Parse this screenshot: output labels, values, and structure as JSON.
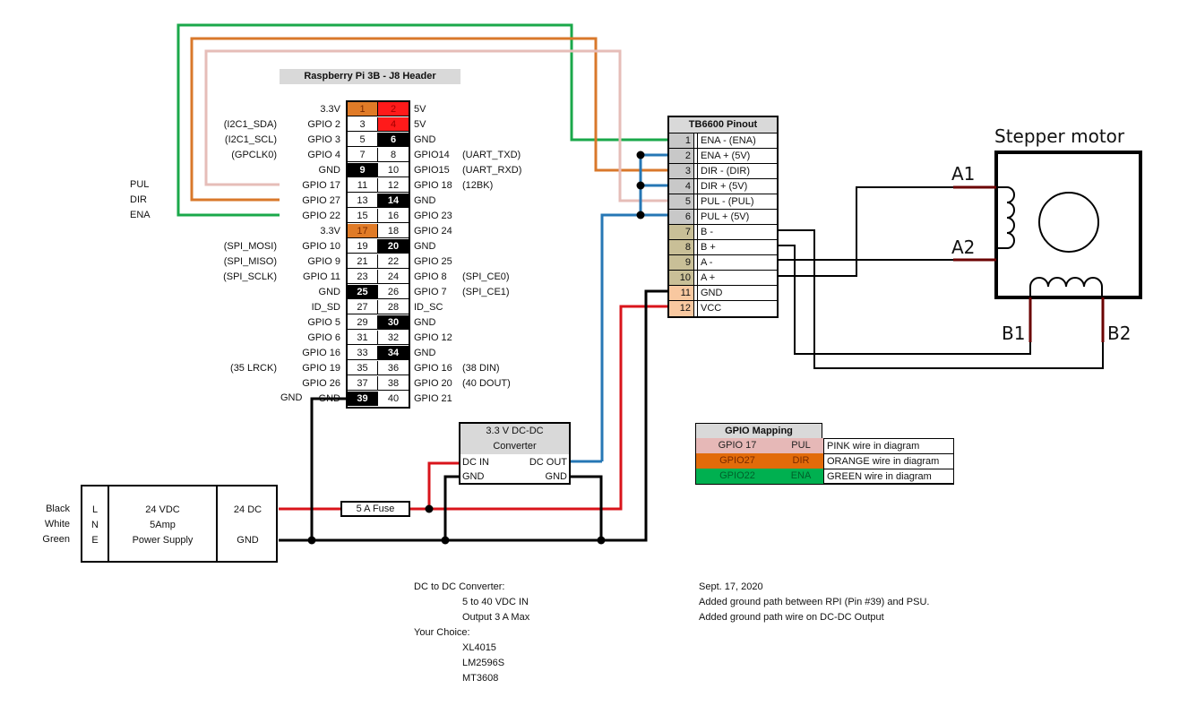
{
  "pi": {
    "title": "Raspberry Pi 3B - J8 Header",
    "rows": [
      {
        "lnote": "",
        "lname": "3.3V",
        "l": "1",
        "lc": "c-33",
        "r": "2",
        "rc": "c-5v",
        "rname": "5V",
        "rnote": ""
      },
      {
        "lnote": "(I2C1_SDA)",
        "lname": "GPIO 2",
        "l": "3",
        "lc": "",
        "r": "4",
        "rc": "c-5v",
        "rname": "5V",
        "rnote": ""
      },
      {
        "lnote": "(I2C1_SCL)",
        "lname": "GPIO 3",
        "l": "5",
        "lc": "",
        "r": "6",
        "rc": "c-gnd",
        "rname": "GND",
        "rnote": ""
      },
      {
        "lnote": "(GPCLK0)",
        "lname": "GPIO 4",
        "l": "7",
        "lc": "",
        "r": "8",
        "rc": "",
        "rname": "GPIO14",
        "rnote": "(UART_TXD)"
      },
      {
        "lnote": "",
        "lname": "GND",
        "l": "9",
        "lc": "c-gnd",
        "r": "10",
        "rc": "",
        "rname": "GPIO15",
        "rnote": "(UART_RXD)"
      },
      {
        "lnote": "",
        "lname": "GPIO 17",
        "l": "11",
        "lc": "",
        "r": "12",
        "rc": "",
        "rname": "GPIO 18",
        "rnote": "(12BK)"
      },
      {
        "lnote": "",
        "lname": "GPIO 27",
        "l": "13",
        "lc": "",
        "r": "14",
        "rc": "c-gnd",
        "rname": "GND",
        "rnote": ""
      },
      {
        "lnote": "",
        "lname": "GPIO 22",
        "l": "15",
        "lc": "",
        "r": "16",
        "rc": "",
        "rname": "GPIO 23",
        "rnote": ""
      },
      {
        "lnote": "",
        "lname": "3.3V",
        "l": "17",
        "lc": "c-33",
        "r": "18",
        "rc": "",
        "rname": "GPIO 24",
        "rnote": ""
      },
      {
        "lnote": "(SPI_MOSI)",
        "lname": "GPIO 10",
        "l": "19",
        "lc": "",
        "r": "20",
        "rc": "c-gnd",
        "rname": "GND",
        "rnote": ""
      },
      {
        "lnote": "(SPI_MISO)",
        "lname": "GPIO 9",
        "l": "21",
        "lc": "",
        "r": "22",
        "rc": "",
        "rname": "GPIO 25",
        "rnote": ""
      },
      {
        "lnote": "(SPI_SCLK)",
        "lname": "GPIO 11",
        "l": "23",
        "lc": "",
        "r": "24",
        "rc": "",
        "rname": "GPIO 8",
        "rnote": "(SPI_CE0)"
      },
      {
        "lnote": "",
        "lname": "GND",
        "l": "25",
        "lc": "c-gnd",
        "r": "26",
        "rc": "",
        "rname": "GPIO 7",
        "rnote": "(SPI_CE1)"
      },
      {
        "lnote": "",
        "lname": "ID_SD",
        "l": "27",
        "lc": "",
        "r": "28",
        "rc": "",
        "rname": "ID_SC",
        "rnote": ""
      },
      {
        "lnote": "",
        "lname": "GPIO 5",
        "l": "29",
        "lc": "",
        "r": "30",
        "rc": "c-gnd",
        "rname": "GND",
        "rnote": ""
      },
      {
        "lnote": "",
        "lname": "GPIO 6",
        "l": "31",
        "lc": "",
        "r": "32",
        "rc": "",
        "rname": "GPIO 12",
        "rnote": ""
      },
      {
        "lnote": "",
        "lname": "GPIO 16",
        "l": "33",
        "lc": "",
        "r": "34",
        "rc": "c-gnd",
        "rname": "GND",
        "rnote": ""
      },
      {
        "lnote": "(35 LRCK)",
        "lname": "GPIO 19",
        "l": "35",
        "lc": "",
        "r": "36",
        "rc": "",
        "rname": "GPIO 16",
        "rnote": "(38 DIN)"
      },
      {
        "lnote": "",
        "lname": "GPIO 26",
        "l": "37",
        "lc": "",
        "r": "38",
        "rc": "",
        "rname": "GPIO 20",
        "rnote": "(40 DOUT)"
      },
      {
        "lnote": "",
        "lname": "GND",
        "l": "39",
        "lc": "c-gnd",
        "r": "40",
        "rc": "",
        "rname": "GPIO 21",
        "rnote": ""
      }
    ],
    "signal_labels": [
      "PUL",
      "DIR",
      "ENA"
    ]
  },
  "tb6600": {
    "title": "TB6600 Pinout",
    "rows": [
      {
        "num": "1",
        "label": "ENA - (ENA)",
        "g": "g1"
      },
      {
        "num": "2",
        "label": "ENA + (5V)",
        "g": "g1"
      },
      {
        "num": "3",
        "label": "DIR - (DIR)",
        "g": "g1"
      },
      {
        "num": "4",
        "label": "DIR + (5V)",
        "g": "g1"
      },
      {
        "num": "5",
        "label": "PUL - (PUL)",
        "g": "g1"
      },
      {
        "num": "6",
        "label": "PUL + (5V)",
        "g": "g1"
      },
      {
        "num": "7",
        "label": "B -",
        "g": "g2"
      },
      {
        "num": "8",
        "label": "B +",
        "g": "g2"
      },
      {
        "num": "9",
        "label": "A -",
        "g": "g2"
      },
      {
        "num": "10",
        "label": "A +",
        "g": "g2"
      },
      {
        "num": "11",
        "label": "GND",
        "g": "g3"
      },
      {
        "num": "12",
        "label": "VCC",
        "g": "g3"
      }
    ]
  },
  "motor": {
    "title": "Stepper motor",
    "a1": "A1",
    "a2": "A2",
    "b1": "B1",
    "b2": "B2"
  },
  "psu": {
    "wire_colors": [
      "Black",
      "White",
      "Green"
    ],
    "terminals": [
      "L",
      "N",
      "E"
    ],
    "line1": "24 VDC",
    "line2": "5Amp",
    "line3": "Power Supply",
    "out_pos": "24 DC",
    "out_gnd": "GND"
  },
  "fuse": {
    "label": "5 A Fuse"
  },
  "dcdc": {
    "title1": "3.3 V DC-DC",
    "title2": "Converter",
    "in": "DC IN",
    "in_gnd": "GND",
    "out": "DC OUT",
    "out_gnd": "GND"
  },
  "pi_gnd_label": "GND",
  "mapping": {
    "title": "GPIO Mapping",
    "rows": [
      {
        "gpio": "GPIO 17",
        "fn": "PUL",
        "desc": "PINK wire in diagram",
        "bg": "#e6b8b7",
        "fg": "#222222"
      },
      {
        "gpio": "GPIO27",
        "fn": "DIR",
        "desc": "ORANGE wire in diagram",
        "bg": "#e26b0a",
        "fg": "#7a2a00"
      },
      {
        "gpio": "GPIO22",
        "fn": "ENA",
        "desc": "GREEN wire in diagram",
        "bg": "#00b050",
        "fg": "#00602a"
      }
    ]
  },
  "notes": {
    "converter": [
      "DC to DC Converter:",
      "5 to 40 VDC IN",
      "Output 3 A Max",
      "Your Choice:",
      "XL4015",
      "LM2596S",
      "MT3608"
    ],
    "changelog": [
      "Sept. 17, 2020",
      "Added ground path between RPI (Pin #39) and PSU.",
      "Added ground path wire on DC-DC Output"
    ]
  },
  "colors": {
    "green_wire": "#1aa84a",
    "orange_wire": "#d9782b",
    "pink_wire": "#e6bdb8",
    "blue_wire": "#2677b5",
    "red_wire": "#d9141b",
    "motor_lead": "#6b0000"
  }
}
